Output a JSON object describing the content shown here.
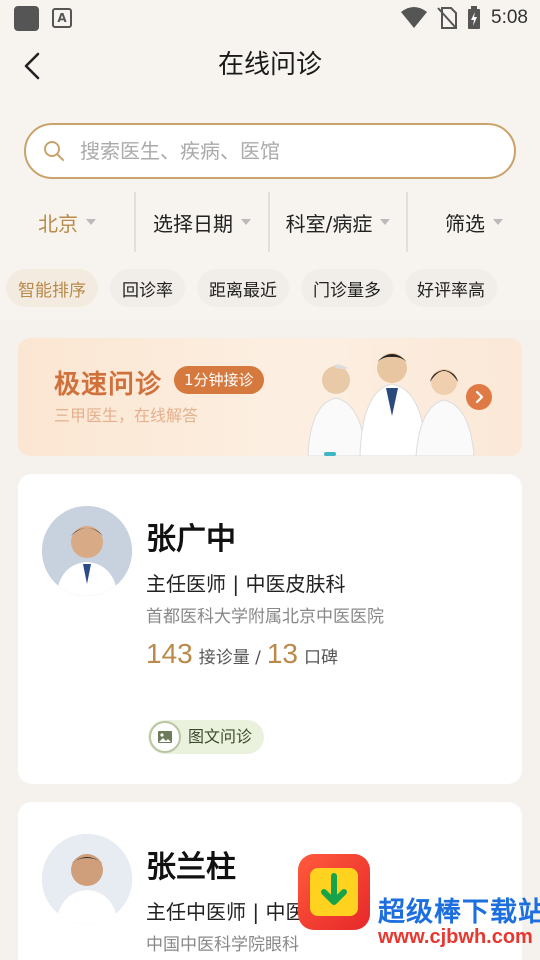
{
  "status_bar": {
    "time": "5:08"
  },
  "header": {
    "title": "在线问诊"
  },
  "search": {
    "placeholder": "搜索医生、疾病、医馆"
  },
  "filters": [
    "北京",
    "选择日期",
    "科室/病症",
    "筛选"
  ],
  "sort_chips": [
    "智能排序",
    "回诊率",
    "距离最近",
    "门诊量多",
    "好评率高"
  ],
  "banner": {
    "title": "极速问诊",
    "tag": "1分钟接诊",
    "subtitle": "三甲医生，在线解答"
  },
  "doctors": [
    {
      "name": "张广中",
      "title": "主任医师 | 中医皮肤科",
      "hospital": "首都医科大学附属北京中医医院",
      "consult_count": "143",
      "consult_label": "接诊量 /",
      "rating_count": "13",
      "rating_label": "口碑",
      "service": "图文问诊"
    },
    {
      "name": "张兰柱",
      "title": "主任中医师 | 中医",
      "hospital": "中国中医科学院眼科"
    }
  ],
  "watermark": {
    "name": "超级棒下载站",
    "url": "www.cjbwh.com"
  },
  "colors": {
    "accent": "#b98a4a",
    "search_border": "#c9a36b",
    "banner_text": "#d0713c"
  }
}
